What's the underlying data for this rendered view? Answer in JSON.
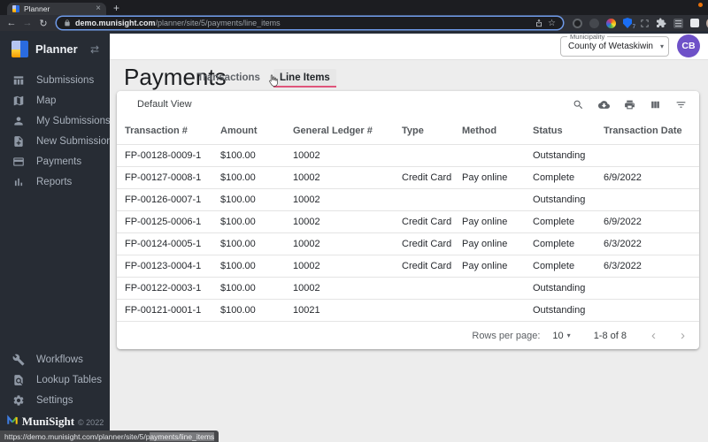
{
  "browser": {
    "tab_title": "Planner",
    "url_domain": "demo.munisight.com",
    "url_path": "/planner/site/5/payments/line_items",
    "extension_badge": "7"
  },
  "icons": {
    "close": "×",
    "new_tab": "+",
    "back": "←",
    "forward": "→",
    "reload": "↻",
    "star": "☆",
    "kebab": "⋮",
    "dropdown": "▾",
    "swap": "⇄",
    "chevron_left": "‹",
    "chevron_right": "›"
  },
  "sidebar": {
    "app_name": "Planner",
    "items": [
      {
        "label": "Submissions",
        "icon": "table-grid-icon"
      },
      {
        "label": "Map",
        "icon": "map-icon"
      },
      {
        "label": "My Submissions",
        "icon": "person-icon"
      },
      {
        "label": "New Submission",
        "icon": "document-add-icon"
      },
      {
        "label": "Payments",
        "icon": "credit-card-icon"
      },
      {
        "label": "Reports",
        "icon": "bar-chart-icon"
      }
    ],
    "bottom_items": [
      {
        "label": "Workflows",
        "icon": "wrench-icon"
      },
      {
        "label": "Lookup Tables",
        "icon": "document-search-icon"
      },
      {
        "label": "Settings",
        "icon": "gear-icon"
      }
    ],
    "brand": "MuniSight",
    "copyright": "© 2022"
  },
  "header": {
    "municipality_label": "Municipality",
    "municipality_value": "County of Wetaskiwin",
    "avatar_initials": "CB"
  },
  "page": {
    "title": "Payments",
    "tabs": [
      {
        "label": "Transactions",
        "active": false
      },
      {
        "label": "Line Items",
        "active": true
      }
    ],
    "view_label": "Default View"
  },
  "table": {
    "columns": [
      "Transaction #",
      "Amount",
      "General Ledger #",
      "Type",
      "Method",
      "Status",
      "Transaction Date"
    ],
    "rows": [
      [
        "FP-00128-0009-1",
        "$100.00",
        "10002",
        "",
        "",
        "Outstanding",
        ""
      ],
      [
        "FP-00127-0008-1",
        "$100.00",
        "10002",
        "Credit Card",
        "Pay online",
        "Complete",
        "6/9/2022"
      ],
      [
        "FP-00126-0007-1",
        "$100.00",
        "10002",
        "",
        "",
        "Outstanding",
        ""
      ],
      [
        "FP-00125-0006-1",
        "$100.00",
        "10002",
        "Credit Card",
        "Pay online",
        "Complete",
        "6/9/2022"
      ],
      [
        "FP-00124-0005-1",
        "$100.00",
        "10002",
        "Credit Card",
        "Pay online",
        "Complete",
        "6/3/2022"
      ],
      [
        "FP-00123-0004-1",
        "$100.00",
        "10002",
        "Credit Card",
        "Pay online",
        "Complete",
        "6/3/2022"
      ],
      [
        "FP-00122-0003-1",
        "$100.00",
        "10002",
        "",
        "",
        "Outstanding",
        ""
      ],
      [
        "FP-00121-0001-1",
        "$100.00",
        "10021",
        "",
        "",
        "Outstanding",
        ""
      ]
    ],
    "pagination": {
      "rows_per_page_label": "Rows per page:",
      "rows_per_page": "10",
      "range": "1-8 of 8"
    }
  },
  "statusbar": {
    "url_prefix": "https://demo.munisight.com/planner/site/5/p",
    "url_highlight": "ayments/line_items"
  },
  "colors": {
    "accent_pink": "#df557b",
    "avatar_purple": "#6e51c8",
    "sidebar_bg": "#272c34",
    "content_bg": "#ededed"
  }
}
